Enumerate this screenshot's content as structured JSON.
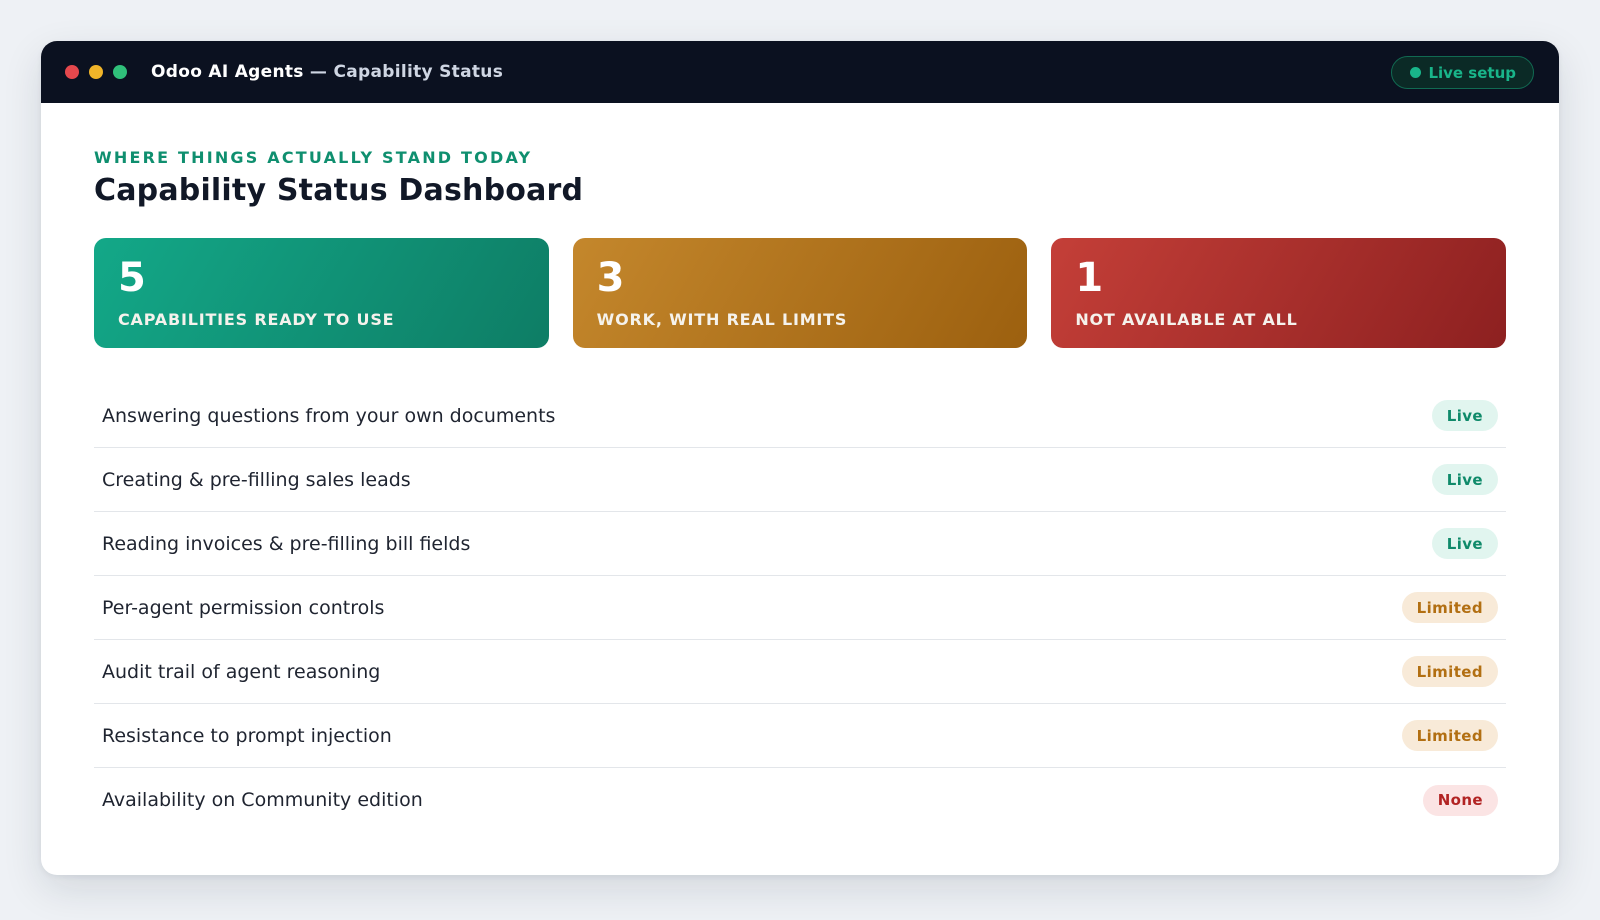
{
  "window": {
    "title": "Odoo AI Agents",
    "title_separator": "—",
    "subtitle": "Capability Status",
    "status_pill": "Live setup"
  },
  "header": {
    "eyebrow": "WHERE THINGS ACTUALLY STAND TODAY",
    "title": "Capability Status Dashboard"
  },
  "stats": [
    {
      "count": "5",
      "label": "CAPABILITIES READY TO USE",
      "color": "#0f8f6f"
    },
    {
      "count": "3",
      "label": "WORK, WITH REAL LIMITS",
      "color": "#b26f12"
    },
    {
      "count": "1",
      "label": "NOT AVAILABLE AT ALL",
      "color": "#b22323"
    }
  ],
  "capabilities": [
    {
      "label": "Answering questions from your own documents",
      "status": "Live"
    },
    {
      "label": "Creating & pre-filling sales leads",
      "status": "Live"
    },
    {
      "label": "Reading invoices & pre-filling bill fields",
      "status": "Live"
    },
    {
      "label": "Per-agent permission controls",
      "status": "Limited"
    },
    {
      "label": "Audit trail of agent reasoning",
      "status": "Limited"
    },
    {
      "label": "Resistance to prompt injection",
      "status": "Limited"
    },
    {
      "label": "Availability on Community edition",
      "status": "None"
    }
  ]
}
